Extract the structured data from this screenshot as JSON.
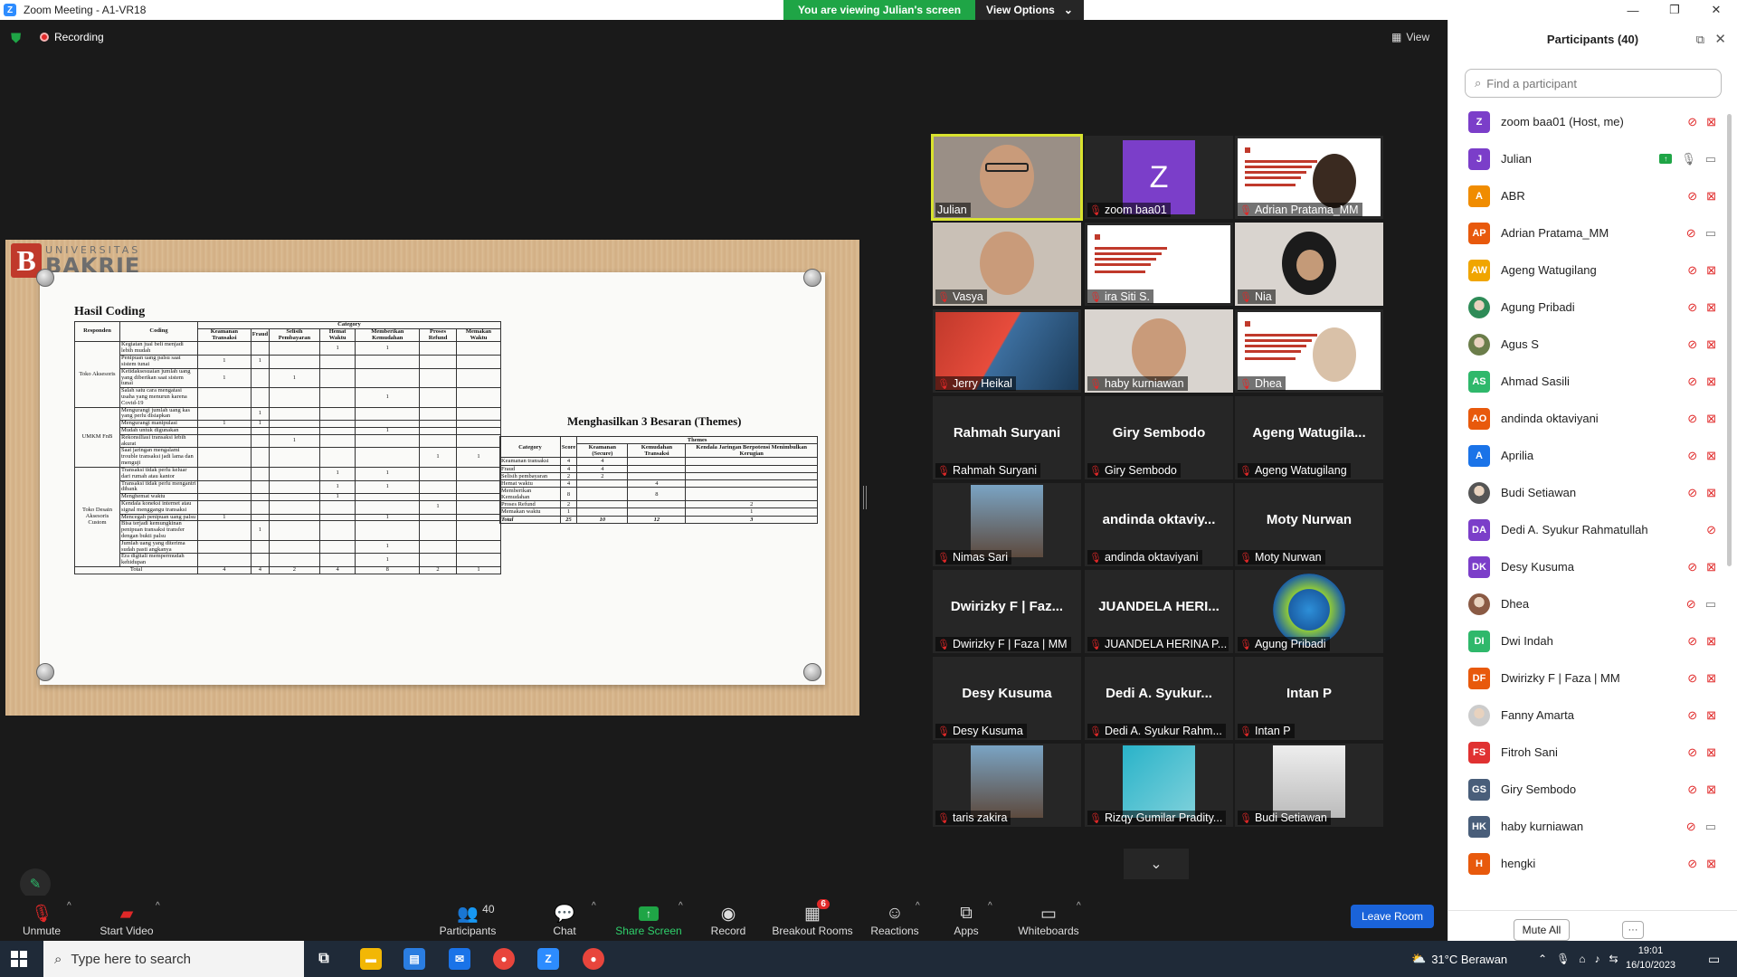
{
  "window": {
    "title": "Zoom Meeting - A1-VR18",
    "min": "—",
    "max": "❐",
    "close": "✕"
  },
  "banner": {
    "viewing": "You are viewing Julian's screen",
    "options": "View Options"
  },
  "topbar": {
    "recording": "Recording",
    "view": "View"
  },
  "shared": {
    "logo_small": "UNIVERSITAS",
    "logo_big": "BAKRIE",
    "coding_title": "Hasil Coding",
    "coding_headers": {
      "responden": "Responden",
      "coding": "Coding",
      "category": "Category",
      "cols": [
        "Keamanan Transaksi",
        "Fraud",
        "Selisih Pembayaran",
        "Hemat Waktu",
        "Memberikan Kemudahan",
        "Proses Refund",
        "Memakan Waktu"
      ]
    },
    "coding_groups": [
      {
        "responden": "Toko Aksesoris",
        "rows": [
          {
            "coding": "Kegiatan jual beli menjadi lebih mudah",
            "v": [
              "",
              "",
              "",
              "1",
              "1",
              "",
              ""
            ]
          },
          {
            "coding": "Penipuan uang palsu saat sistem tunai",
            "v": [
              "1",
              "1",
              "",
              "",
              "",
              "",
              ""
            ]
          },
          {
            "coding": "Ketidaksesuaian jumlah uang yang diberikan saat sistem tunai",
            "v": [
              "1",
              "",
              "1",
              "",
              "",
              "",
              ""
            ]
          },
          {
            "coding": "Salah satu cara mengatasi usaha yang menurun karena Covid-19",
            "v": [
              "",
              "",
              "",
              "",
              "1",
              "",
              ""
            ]
          }
        ]
      },
      {
        "responden": "UMKM FnB",
        "rows": [
          {
            "coding": "Mengurangi jumlah uang kas yang perlu disiapkan",
            "v": [
              "",
              "1",
              "",
              "",
              "",
              "",
              ""
            ]
          },
          {
            "coding": "Mengurangi manipulasi",
            "v": [
              "1",
              "1",
              "",
              "",
              "",
              "",
              ""
            ]
          },
          {
            "coding": "Mudah untuk digunakan",
            "v": [
              "",
              "",
              "",
              "",
              "1",
              "",
              ""
            ]
          },
          {
            "coding": "Rekonsiliasi transaksi lebih akurat",
            "v": [
              "",
              "",
              "1",
              "",
              "",
              "",
              ""
            ]
          },
          {
            "coding": "Saat jaringan mengalami trouble transaksi jadi lama dan menguji",
            "v": [
              "",
              "",
              "",
              "",
              "",
              "1",
              "1"
            ]
          }
        ]
      },
      {
        "responden": "Toko Desain Aksesoris Custom",
        "rows": [
          {
            "coding": "Transaksi tidak perlu keluar dari rumah atau kantor",
            "v": [
              "",
              "",
              "",
              "1",
              "1",
              "",
              ""
            ]
          },
          {
            "coding": "Transaksi tidak perlu mengantri dibank",
            "v": [
              "",
              "",
              "",
              "1",
              "1",
              "",
              ""
            ]
          },
          {
            "coding": "Menghemat waktu",
            "v": [
              "",
              "",
              "",
              "1",
              "",
              "",
              ""
            ]
          },
          {
            "coding": "Kendala koneksi internet atau signal menggangu transaksi",
            "v": [
              "",
              "",
              "",
              "",
              "",
              "1",
              ""
            ]
          },
          {
            "coding": "Mencegah penipuan uang palsu",
            "v": [
              "1",
              "",
              "",
              "",
              "1",
              "",
              ""
            ]
          },
          {
            "coding": "Bisa terjadi kemungkinan penipuan transaksi transfer dengan bukti palsu",
            "v": [
              "",
              "1",
              "",
              "",
              "",
              "",
              ""
            ]
          },
          {
            "coding": "Jumlah uang yang diterima sudah pasti angkanya",
            "v": [
              "",
              "",
              "",
              "",
              "1",
              "",
              ""
            ]
          },
          {
            "coding": "Era digitali mempermudah kehidupan",
            "v": [
              "",
              "",
              "",
              "",
              "1",
              "",
              ""
            ]
          }
        ]
      }
    ],
    "coding_total": {
      "label": "Total",
      "v": [
        "4",
        "4",
        "2",
        "4",
        "8",
        "2",
        "1"
      ]
    },
    "themes_title": "Menghasilkan 3 Besaran (Themes)",
    "themes_headers": {
      "category": "Category",
      "score": "Score",
      "themes": "Themes",
      "cols": [
        "Keamanan (Secure)",
        "Kemudahan Transaksi",
        "Kendala Jaringan Berpotensi Menimbulkan Kerugian"
      ]
    },
    "themes_rows": [
      {
        "c": "Keamanan transaksi",
        "s": "4",
        "v": [
          "4",
          "",
          ""
        ]
      },
      {
        "c": "Fraud",
        "s": "4",
        "v": [
          "4",
          "",
          ""
        ]
      },
      {
        "c": "Selisih pembayaran",
        "s": "2",
        "v": [
          "2",
          "",
          ""
        ]
      },
      {
        "c": "Hemat waktu",
        "s": "4",
        "v": [
          "",
          "4",
          ""
        ]
      },
      {
        "c": "Memberikan Kemudahan",
        "s": "8",
        "v": [
          "",
          "8",
          ""
        ]
      },
      {
        "c": "Proses Refund",
        "s": "2",
        "v": [
          "",
          "",
          "2"
        ]
      },
      {
        "c": "Memakan waktu",
        "s": "1",
        "v": [
          "",
          "",
          "1"
        ]
      }
    ],
    "themes_total": {
      "c": "Total",
      "s": "25",
      "v": [
        "10",
        "12",
        "3"
      ]
    }
  },
  "gallery": [
    {
      "name": "Julian",
      "type": "video",
      "active": true,
      "mic_off": false
    },
    {
      "name": "zoom baa01",
      "type": "avatar",
      "letter": "Z",
      "mic_off": true
    },
    {
      "name": "Adrian Pratama_MM",
      "type": "slide-video",
      "mic_off": true
    },
    {
      "name": "Vasya",
      "type": "video",
      "mic_off": true
    },
    {
      "name": "ira Siti S.",
      "type": "slide",
      "mic_off": true
    },
    {
      "name": "Nia",
      "type": "video",
      "mic_off": true
    },
    {
      "name": "Jerry Heikal",
      "type": "image",
      "mic_off": true
    },
    {
      "name": "haby kurniawan",
      "type": "video",
      "mic_off": true
    },
    {
      "name": "Dhea",
      "type": "slide-video",
      "mic_off": true
    },
    {
      "name": "Rahmah Suryani",
      "big": "Rahmah Suryani",
      "type": "name",
      "mic_off": true
    },
    {
      "name": "Giry Sembodo",
      "big": "Giry Sembodo",
      "type": "name",
      "mic_off": true
    },
    {
      "name": "Ageng Watugilang",
      "big": "Ageng Watugila...",
      "type": "name",
      "mic_off": true
    },
    {
      "name": "Nimas Sari",
      "type": "photo",
      "mic_off": true
    },
    {
      "name": "andinda oktaviyani",
      "big": "andinda oktaviy...",
      "type": "name",
      "mic_off": true
    },
    {
      "name": "Moty Nurwan",
      "big": "Moty Nurwan",
      "type": "name",
      "mic_off": true
    },
    {
      "name": "Dwirizky F | Faza | MM",
      "big": "Dwirizky F | Faz...",
      "type": "name",
      "mic_off": true
    },
    {
      "name": "JUANDELA HERINA P...",
      "big": "JUANDELA HERI...",
      "type": "name",
      "mic_off": true
    },
    {
      "name": "Agung Pribadi",
      "type": "logo",
      "mic_off": true
    },
    {
      "name": "Desy Kusuma",
      "big": "Desy Kusuma",
      "type": "name",
      "mic_off": true
    },
    {
      "name": "Dedi A. Syukur Rahm...",
      "big": "Dedi A. Syukur...",
      "type": "name",
      "mic_off": true
    },
    {
      "name": "Intan P",
      "big": "Intan P",
      "type": "name",
      "mic_off": true
    },
    {
      "name": "taris zakira",
      "type": "photo",
      "mic_off": true
    },
    {
      "name": "Rizqy Gumilar Pradity...",
      "type": "photo2",
      "mic_off": true
    },
    {
      "name": "Budi Setiawan",
      "type": "photo3",
      "mic_off": true
    }
  ],
  "toolbar": {
    "unmute": "Unmute",
    "start_video": "Start Video",
    "participants": "Participants",
    "participants_count": "40",
    "chat": "Chat",
    "share": "Share Screen",
    "record": "Record",
    "breakout": "Breakout Rooms",
    "breakout_badge": "6",
    "reactions": "Reactions",
    "apps": "Apps",
    "whiteboards": "Whiteboards",
    "leave": "Leave Room"
  },
  "panel": {
    "title": "Participants (40)",
    "search_placeholder": "Find a participant",
    "mute_all": "Mute All",
    "more": "···",
    "participants": [
      {
        "name": "zoom baa01 (Host, me)",
        "initials": "Z",
        "color": "#7b3ec9",
        "video": "off"
      },
      {
        "name": "Julian",
        "initials": "J",
        "color": "#7b3ec9",
        "video": "on",
        "sharing": true
      },
      {
        "name": "ABR",
        "initials": "A",
        "color": "#f08c00",
        "video": "off"
      },
      {
        "name": "Adrian Pratama_MM",
        "initials": "AP",
        "color": "#e8590c",
        "video": "on"
      },
      {
        "name": "Ageng Watugilang",
        "initials": "AW",
        "color": "#f0a500",
        "video": "off"
      },
      {
        "name": "Agung Pribadi",
        "initials": "",
        "color": "#2e8b57",
        "video": "off",
        "image": true
      },
      {
        "name": "Agus S",
        "initials": "",
        "color": "#6b7d4a",
        "video": "off",
        "image": true
      },
      {
        "name": "Ahmad Sasili",
        "initials": "AS",
        "color": "#2fb86b",
        "video": "off"
      },
      {
        "name": "andinda oktaviyani",
        "initials": "AO",
        "color": "#e8590c",
        "video": "off"
      },
      {
        "name": "Aprilia",
        "initials": "A",
        "color": "#1a73e8",
        "video": "off"
      },
      {
        "name": "Budi Setiawan",
        "initials": "",
        "color": "#555555",
        "video": "off",
        "image": true
      },
      {
        "name": "Dedi A. Syukur Rahmatullah",
        "initials": "DA",
        "color": "#7b3ec9",
        "video": "none"
      },
      {
        "name": "Desy Kusuma",
        "initials": "DK",
        "color": "#7b3ec9",
        "video": "off"
      },
      {
        "name": "Dhea",
        "initials": "",
        "color": "#8a5a44",
        "video": "on",
        "image": true
      },
      {
        "name": "Dwi Indah",
        "initials": "DI",
        "color": "#2fb86b",
        "video": "off"
      },
      {
        "name": "Dwirizky F | Faza | MM",
        "initials": "DF",
        "color": "#e8590c",
        "video": "off"
      },
      {
        "name": "Fanny Amarta",
        "initials": "",
        "color": "#cccccc",
        "video": "off",
        "image": true
      },
      {
        "name": "Fitroh Sani",
        "initials": "FS",
        "color": "#e03131",
        "video": "off"
      },
      {
        "name": "Giry Sembodo",
        "initials": "GS",
        "color": "#495e7a",
        "video": "off"
      },
      {
        "name": "haby kurniawan",
        "initials": "HK",
        "color": "#495e7a",
        "video": "on"
      },
      {
        "name": "hengki",
        "initials": "H",
        "color": "#e8590c",
        "video": "off"
      }
    ]
  },
  "taskbar": {
    "search": "Type here to search",
    "weather": "31°C  Berawan",
    "time": "19:01",
    "date": "16/10/2023"
  },
  "colors": {
    "accent_green": "#1fa546",
    "mute_red": "#e02828",
    "zoom_blue": "#2d8cff",
    "active_speaker": "#d9e32e"
  }
}
